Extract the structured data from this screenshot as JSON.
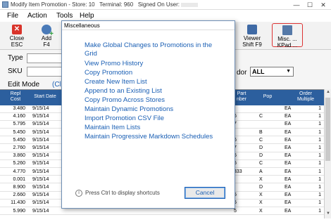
{
  "window": {
    "title_prefix": "Modify Item Promotion - Store: 10",
    "title_terminal": "Terminal: 960",
    "title_signed": "Signed On User:",
    "controls": [
      "—",
      "☐",
      "✕"
    ]
  },
  "menu": [
    "File",
    "Action",
    "Tools",
    "Help"
  ],
  "toolbar": {
    "close": {
      "line1": "Close",
      "line2": "ESC"
    },
    "add": {
      "line1": "Add",
      "line2": "F4"
    },
    "viewer": {
      "line1": "Viewer",
      "line2": "Shift F9"
    },
    "misc": {
      "line1": "Misc. ...",
      "line2": "KPad ..."
    }
  },
  "form": {
    "type_label": "Type",
    "sku_label": "SKU",
    "edit_mode_label": "Edit Mode",
    "edit_mode_link": "(Clic",
    "vendor_label": "dor",
    "vendor_value": "ALL"
  },
  "grid": {
    "headers": {
      "repl_cost": "Repl\nCost",
      "start_date": "Start Date",
      "part_number": "Part\nnber",
      "pop": "Pop",
      "order_multiple": "Order\nMultiple"
    },
    "rows": [
      {
        "cost": "3.480",
        "date": "9/15/14",
        "part": "",
        "pop": "",
        "um": "EA",
        "mult": "1"
      },
      {
        "cost": "4.160",
        "date": "9/15/14",
        "part": "6",
        "pop": "C",
        "um": "EA",
        "mult": "1"
      },
      {
        "cost": "5.795",
        "date": "9/15/14",
        "part": "7",
        "pop": "",
        "um": "EA",
        "mult": "1"
      },
      {
        "cost": "5.450",
        "date": "9/15/14",
        "part": "",
        "pop": "B",
        "um": "EA",
        "mult": "1"
      },
      {
        "cost": "5.450",
        "date": "9/15/14",
        "part": "6",
        "pop": "C",
        "um": "EA",
        "mult": "1"
      },
      {
        "cost": "2.760",
        "date": "9/15/14",
        "part": "7",
        "pop": "D",
        "um": "EA",
        "mult": "1"
      },
      {
        "cost": "3.860",
        "date": "9/15/14",
        "part": "5",
        "pop": "D",
        "um": "EA",
        "mult": "1"
      },
      {
        "cost": "5.260",
        "date": "9/15/14",
        "part": "5",
        "pop": "C",
        "um": "EA",
        "mult": "1"
      },
      {
        "cost": "4.770",
        "date": "9/15/14",
        "part": "333",
        "pop": "A",
        "um": "EA",
        "mult": "1"
      },
      {
        "cost": "0.001",
        "date": "9/15/14",
        "part": "",
        "pop": "X",
        "um": "EA",
        "mult": "1"
      },
      {
        "cost": "8.900",
        "date": "9/15/14",
        "part": "",
        "pop": "D",
        "um": "EA",
        "mult": "1"
      },
      {
        "cost": "2.660",
        "date": "9/15/14",
        "part": "5",
        "pop": "X",
        "um": "EA",
        "mult": "1"
      },
      {
        "cost": "11.430",
        "date": "9/15/14",
        "part": "5",
        "pop": "X",
        "um": "EA",
        "mult": "1"
      },
      {
        "cost": "5.990",
        "date": "9/15/14",
        "part": "5",
        "pop": "X",
        "um": "EA",
        "mult": "1"
      }
    ]
  },
  "dialog": {
    "title": "Miscellaneous",
    "options": [
      "Make Global Changes to Promotions in the",
      "Grid",
      "View Promo History",
      "Copy Promotion",
      "Create New Item List",
      "Append to an Existing List",
      "Copy Promo Across Stores",
      "Maintain Dynamic Promotions",
      "Import Promotion CSV File",
      "Maintain Item Lists",
      "Maintain Progressive Markdown Schedules"
    ],
    "hint": "Press Ctrl to display shortcuts",
    "cancel_label": "Cancel"
  },
  "colors": {
    "grid_header": "#2c5f9e",
    "link": "#1a5fb4",
    "misc_highlight": "#dd3333"
  }
}
